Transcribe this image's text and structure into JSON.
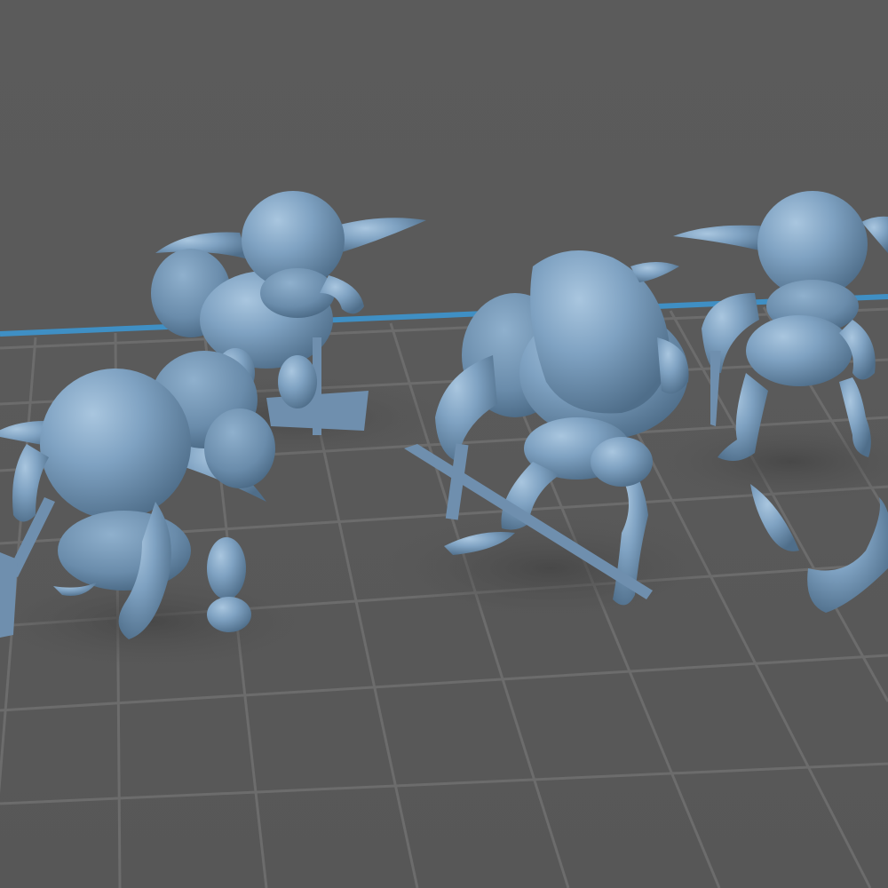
{
  "viewport": {
    "background_color": "#595959",
    "grid_line_color": "#6c6c6c",
    "build_plate_edge_color": "#3f8fc4",
    "model_color": "#7fa2c2",
    "model_shadow_color": "#4e4e4e"
  },
  "scene": {
    "models": [
      {
        "id": "goblin-back-left",
        "icon": "goblin-figure-icon",
        "weapon": "axe"
      },
      {
        "id": "goblin-front-left",
        "icon": "goblin-figure-icon",
        "weapon": "axe"
      },
      {
        "id": "goblin-center",
        "icon": "goblin-figure-icon",
        "weapon": "sword"
      },
      {
        "id": "goblin-right",
        "icon": "goblin-figure-icon",
        "weapon": "dagger"
      }
    ]
  }
}
